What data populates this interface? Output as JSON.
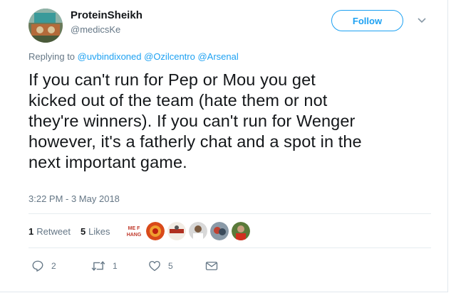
{
  "user": {
    "display_name": "ProteinSheikh",
    "handle": "@medicsKe"
  },
  "follow_label": "Follow",
  "reply_context": {
    "prefix": "Replying to",
    "mentions": [
      "@uvbindixoned",
      "@Ozilcentro",
      "@Arsenal"
    ]
  },
  "tweet": {
    "lines": [
      "If you can't run for Pep or Mou you get",
      "kicked out of the team (hate them or not",
      "they're winners). If you can't run for Wenger",
      "however, it's a fatherly chat and a spot in the",
      "next important game."
    ],
    "timestamp": "3:22 PM - 3 May 2018"
  },
  "stats": {
    "retweets_count": "1",
    "retweets_label": "Retweet",
    "likes_count": "5",
    "likes_label": "Likes"
  },
  "likers": [
    {
      "name": "liker-avatar-1",
      "text": "ME F‐ HANG"
    },
    {
      "name": "liker-avatar-2"
    },
    {
      "name": "liker-avatar-3"
    },
    {
      "name": "liker-avatar-4"
    },
    {
      "name": "liker-avatar-5"
    },
    {
      "name": "liker-avatar-6"
    }
  ],
  "actions": {
    "reply_count": "2",
    "retweet_count": "1",
    "like_count": "5"
  },
  "colors": {
    "accent": "#1da1f2",
    "secondary_text": "#657786",
    "primary_text": "#14171a"
  }
}
